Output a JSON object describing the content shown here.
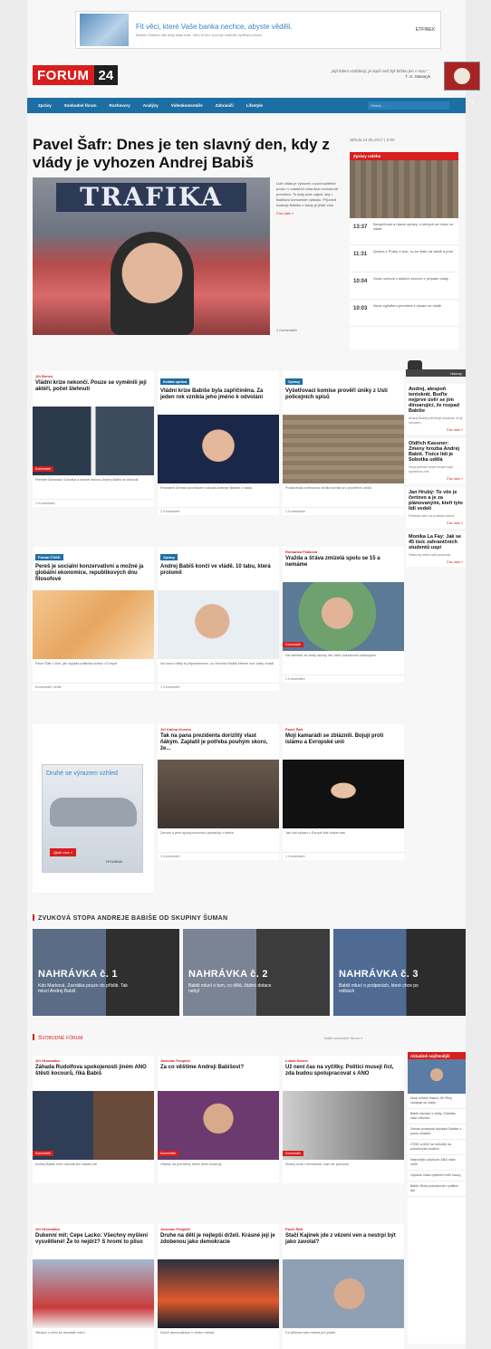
{
  "ad_top": {
    "title": "Fit věci, které Vaše banka nechce, abyste věděli.",
    "text": "Banka Ostrava nás tady kopírovat. Vám to bez rozvoje znalosti vydělat pomoci",
    "brand": "ETFINEX"
  },
  "header": {
    "logo_red": "FORUM",
    "logo_dark": "24",
    "quote": "„Být lidem vzdálený, je lepší než být blízko jen v noci.“",
    "quote_author": "T. G. Masaryk"
  },
  "nav": {
    "items": [
      "Zprávy",
      "Svobodné fórum",
      "Rozhovory",
      "Analýzy",
      "Videokomentáře",
      "Zahraničí",
      "Lifestyle"
    ],
    "search_placeholder": "Hledat ..."
  },
  "hero": {
    "title": "Pavel Šafr: Dnes je ten slavný den, kdy z vlády je vyhozen Andrej Babiš",
    "sign_text": "TRAFIKA",
    "excerpt": "Lidé vláda je vyhozen a pochopitelně proto i v ostatních stranách rozhodnutí premiéra. To tady poté zajistí, aby i Babišovi komunisté výkladu. Připravit Andreje Babiše z vlády je ještě více",
    "more": "Číst dále »",
    "byline": "1 Komentáře"
  },
  "dateline": "Středa 24.05.2017 | 0:00",
  "top_right": {
    "header": "Zprávy celého",
    "rows": [
      {
        "time": "13:37",
        "text": "Bezpečnost a hlavní zprávy, o kterých se mluví ve vládě"
      },
      {
        "time": "11:31",
        "text": "Zpráva z Prahy o tom, co se stalo na vládě a proč"
      },
      {
        "time": "10:04",
        "text": "Soud rozhodl o dalších krocích v případu vlády"
      },
      {
        "time": "10:03",
        "text": "Nová vyjádření premiéra k situaci ve vládě"
      }
    ]
  },
  "cards": [
    {
      "cat": "Jiří Beneš",
      "cat_blue": false,
      "title": "Vládní krize nekončí. Pouze se vyměnili její aktéři, počet šlehnutí",
      "badge": "",
      "excerpt": "Premiér Bohuslav Sobotka a ministr financí Andrej Babiš se dohodli",
      "by": "1 Komentáře"
    },
    {
      "cat": "Krátká zpráva",
      "cat_blue": true,
      "title": "Vládní krize Babiše byla zapříčiněna. Za jeden rok vznikla jeho jméno k odvolání",
      "badge": "",
      "excerpt": "Prezident Zeman pod tlakem odvolal Andreje Babiše z vlády",
      "by": "2 Komentáře"
    },
    {
      "cat": "Zprávy",
      "cat_blue": true,
      "title": "Vyšetřovací komise prověří úniky z Ústí policejních spisů",
      "badge": "",
      "excerpt": "Poslanecká sněmovna zřídila komisi pro prověření úniků",
      "by": "1 Komentáře"
    },
    {
      "cat": "Pořadí ČSSD",
      "cat_blue": true,
      "title": "Pereš je socialní konzervativní a možné ja globální ekonomice, republikových dnu filosofové",
      "badge": "",
      "excerpt": "Pavel Šafr o tom, jak vypadá politická scéna v Evropě",
      "by": "Komentáře Jedle"
    },
    {
      "cat": "Zprávy",
      "cat_blue": true,
      "title": "Andrej Babiš končí ve vládě. 10 tabu, která prolomil",
      "badge": "",
      "excerpt": "Na konci vlády si připomeneme, co všechno Babiš během své vlády zvládl",
      "by": "1 Komentáře"
    },
    {
      "cat": "Romanka Fialková",
      "cat_blue": false,
      "title": "Vražda a šťáva zmizelá spolu se 15 a nemáme",
      "badge": "",
      "excerpt": "Na náměstí se sešly stovky lidí, kteří požadovali odstoupení",
      "by": "1 Komentáře"
    },
    {
      "cat": "Jiří Kalina Kucera",
      "cat_blue": false,
      "title": "Tak na pana prezidenta dorizlitý vlast ňákým. Zaplatil je potřeba pouhým skoro, že...",
      "badge": "",
      "excerpt": "Zeman a jeho spolupracovníci pokračují v kritice",
      "by": "1 Komentáře"
    },
    {
      "cat": "Pavel Šafr",
      "cat_blue": false,
      "title": "Moji kamarádi se zbláznili. Bojují proti islámu a Evropské unii",
      "badge": "",
      "excerpt": "Jak vidí situaci v Evropě lidé kolem nás",
      "by": "1 Komentáře"
    }
  ],
  "opinion_label": "Názory",
  "side_items": [
    {
      "h": "Andrej, alespoň tentokrát. Buďte nejprve úvěr se jím dinsarující, že rozpad Babiše",
      "p": "Andrej Babiš potřebuje dokázat, že je schopen",
      "m": "Číst dále »"
    },
    {
      "h": "Oldřich Kassner: Zmeny hrozba Andrej Babiš. Tisíce lidí je Sobotka udělá",
      "p": "Nový premiér bude muset najít společnou řeč",
      "m": "Číst dále »"
    },
    {
      "h": "Jan Hrubý: To vše je čertovo a je za plánovanými, kteří tyto lidi vedeli",
      "p": "Politické dění na pražské scéně",
      "m": "Číst dále »"
    },
    {
      "h": "Monika La Fay: Jak se 45 tisíc zahraničních studentů uspí",
      "p": "Vláda by měla začít pracovat",
      "m": "Číst dále »"
    }
  ],
  "ad_car": {
    "headline": "Druhé se výrazem vzhled",
    "cta": "Zjistit více »",
    "brand": "HYUNDAI"
  },
  "audio": {
    "section_title": "ZVUKOVÁ STOPA ANDREJE BABIŠE OD SKUPINY ŠUMAN",
    "recordings": [
      {
        "label": "NAHRÁVKA č. 1",
        "desc": "Kdo Marková, Zavrátka pouze do příslib. Tak mluví Andrej Babiš"
      },
      {
        "label": "NAHRÁVKA č. 2",
        "desc": "Babiš mluví o tom, co dělá, žádné dotace nebyl"
      },
      {
        "label": "NAHRÁVKA č. 3",
        "desc": "Babiš mluví o podporách, které chce po volbách"
      }
    ]
  },
  "free_forum": {
    "title": "Svobodné fórum",
    "more": "Další svobodné fórum »",
    "cards": [
      {
        "cat": "Jiří Hromádka",
        "title": "Záhada Rudolfova spokojenosti jiném ANO štěstí kocourů, říká Babiš",
        "excerpt": "Andrej Babiš chce odvolat jen vlastní lidi",
        "badge": "Komentáře"
      },
      {
        "cat": "Jaroslav Pospíšil",
        "title": "Za co věštíme Andreji Babišovi?",
        "excerpt": "Otázky na premiéra, které dnes rezonují",
        "badge": "Komentáře"
      },
      {
        "cat": "Lukáš Nosek",
        "title": "Už není čas na vyčítky. Politici musejí říct, zda budou spolupracovat s ANO",
        "excerpt": "Strany musí rozhodnout, kam se posunou",
        "badge": "Komentáře"
      },
      {
        "cat": "Jiří Hromádka",
        "title": "Dukenní mít: Čepe Lacko: Všechny myšlení vysvětlené! Že to nejdrž? S hromí to pliso",
        "excerpt": "Situace v zemi se neustále mění",
        "badge": ""
      },
      {
        "cat": "Jaroslav Pospíšil",
        "title": "Druhe na děti je nejlepší drželi. Krásné její je zdobenou jako demokracie",
        "excerpt": "Noční demonstrace v centru města",
        "badge": ""
      },
      {
        "cat": "Pavel Šafr",
        "title": "Stačí Kajínek jde z vězení ven a nestrpí být jako zavolal?",
        "excerpt": "Co přinese tato změna pro justici",
        "badge": ""
      }
    ],
    "news_box": {
      "header": "Aktuálně nejčtenější",
      "lines": [
        "Nový ministr financí Jiří Pilný vstupuje do vlády",
        "Babiš odchází z vlády, Sobotka slaví vítězství",
        "Zeman podepsal odvolání Babiše z postu ministra",
        "ČSSD a ANO se dohodly na pokračování koalice",
        "Nejnovější průzkum: ANO stále vede",
        "Opozice žádá vyšetření celé kauzy",
        "Babiš: Budu pokračovat v politice dál"
      ]
    }
  }
}
